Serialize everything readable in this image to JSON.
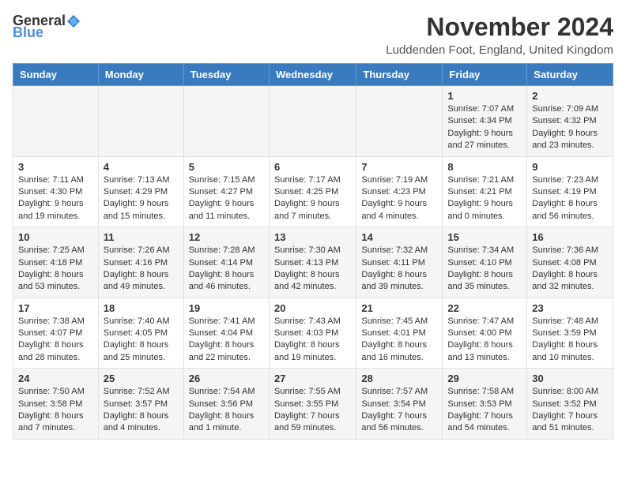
{
  "logo": {
    "text_general": "General",
    "text_blue": "Blue"
  },
  "title": "November 2024",
  "location": "Luddenden Foot, England, United Kingdom",
  "days_of_week": [
    "Sunday",
    "Monday",
    "Tuesday",
    "Wednesday",
    "Thursday",
    "Friday",
    "Saturday"
  ],
  "weeks": [
    [
      {
        "day": "",
        "content": ""
      },
      {
        "day": "",
        "content": ""
      },
      {
        "day": "",
        "content": ""
      },
      {
        "day": "",
        "content": ""
      },
      {
        "day": "",
        "content": ""
      },
      {
        "day": "1",
        "content": "Sunrise: 7:07 AM\nSunset: 4:34 PM\nDaylight: 9 hours and 27 minutes."
      },
      {
        "day": "2",
        "content": "Sunrise: 7:09 AM\nSunset: 4:32 PM\nDaylight: 9 hours and 23 minutes."
      }
    ],
    [
      {
        "day": "3",
        "content": "Sunrise: 7:11 AM\nSunset: 4:30 PM\nDaylight: 9 hours and 19 minutes."
      },
      {
        "day": "4",
        "content": "Sunrise: 7:13 AM\nSunset: 4:29 PM\nDaylight: 9 hours and 15 minutes."
      },
      {
        "day": "5",
        "content": "Sunrise: 7:15 AM\nSunset: 4:27 PM\nDaylight: 9 hours and 11 minutes."
      },
      {
        "day": "6",
        "content": "Sunrise: 7:17 AM\nSunset: 4:25 PM\nDaylight: 9 hours and 7 minutes."
      },
      {
        "day": "7",
        "content": "Sunrise: 7:19 AM\nSunset: 4:23 PM\nDaylight: 9 hours and 4 minutes."
      },
      {
        "day": "8",
        "content": "Sunrise: 7:21 AM\nSunset: 4:21 PM\nDaylight: 9 hours and 0 minutes."
      },
      {
        "day": "9",
        "content": "Sunrise: 7:23 AM\nSunset: 4:19 PM\nDaylight: 8 hours and 56 minutes."
      }
    ],
    [
      {
        "day": "10",
        "content": "Sunrise: 7:25 AM\nSunset: 4:18 PM\nDaylight: 8 hours and 53 minutes."
      },
      {
        "day": "11",
        "content": "Sunrise: 7:26 AM\nSunset: 4:16 PM\nDaylight: 8 hours and 49 minutes."
      },
      {
        "day": "12",
        "content": "Sunrise: 7:28 AM\nSunset: 4:14 PM\nDaylight: 8 hours and 46 minutes."
      },
      {
        "day": "13",
        "content": "Sunrise: 7:30 AM\nSunset: 4:13 PM\nDaylight: 8 hours and 42 minutes."
      },
      {
        "day": "14",
        "content": "Sunrise: 7:32 AM\nSunset: 4:11 PM\nDaylight: 8 hours and 39 minutes."
      },
      {
        "day": "15",
        "content": "Sunrise: 7:34 AM\nSunset: 4:10 PM\nDaylight: 8 hours and 35 minutes."
      },
      {
        "day": "16",
        "content": "Sunrise: 7:36 AM\nSunset: 4:08 PM\nDaylight: 8 hours and 32 minutes."
      }
    ],
    [
      {
        "day": "17",
        "content": "Sunrise: 7:38 AM\nSunset: 4:07 PM\nDaylight: 8 hours and 28 minutes."
      },
      {
        "day": "18",
        "content": "Sunrise: 7:40 AM\nSunset: 4:05 PM\nDaylight: 8 hours and 25 minutes."
      },
      {
        "day": "19",
        "content": "Sunrise: 7:41 AM\nSunset: 4:04 PM\nDaylight: 8 hours and 22 minutes."
      },
      {
        "day": "20",
        "content": "Sunrise: 7:43 AM\nSunset: 4:03 PM\nDaylight: 8 hours and 19 minutes."
      },
      {
        "day": "21",
        "content": "Sunrise: 7:45 AM\nSunset: 4:01 PM\nDaylight: 8 hours and 16 minutes."
      },
      {
        "day": "22",
        "content": "Sunrise: 7:47 AM\nSunset: 4:00 PM\nDaylight: 8 hours and 13 minutes."
      },
      {
        "day": "23",
        "content": "Sunrise: 7:48 AM\nSunset: 3:59 PM\nDaylight: 8 hours and 10 minutes."
      }
    ],
    [
      {
        "day": "24",
        "content": "Sunrise: 7:50 AM\nSunset: 3:58 PM\nDaylight: 8 hours and 7 minutes."
      },
      {
        "day": "25",
        "content": "Sunrise: 7:52 AM\nSunset: 3:57 PM\nDaylight: 8 hours and 4 minutes."
      },
      {
        "day": "26",
        "content": "Sunrise: 7:54 AM\nSunset: 3:56 PM\nDaylight: 8 hours and 1 minute."
      },
      {
        "day": "27",
        "content": "Sunrise: 7:55 AM\nSunset: 3:55 PM\nDaylight: 7 hours and 59 minutes."
      },
      {
        "day": "28",
        "content": "Sunrise: 7:57 AM\nSunset: 3:54 PM\nDaylight: 7 hours and 56 minutes."
      },
      {
        "day": "29",
        "content": "Sunrise: 7:58 AM\nSunset: 3:53 PM\nDaylight: 7 hours and 54 minutes."
      },
      {
        "day": "30",
        "content": "Sunrise: 8:00 AM\nSunset: 3:52 PM\nDaylight: 7 hours and 51 minutes."
      }
    ]
  ]
}
